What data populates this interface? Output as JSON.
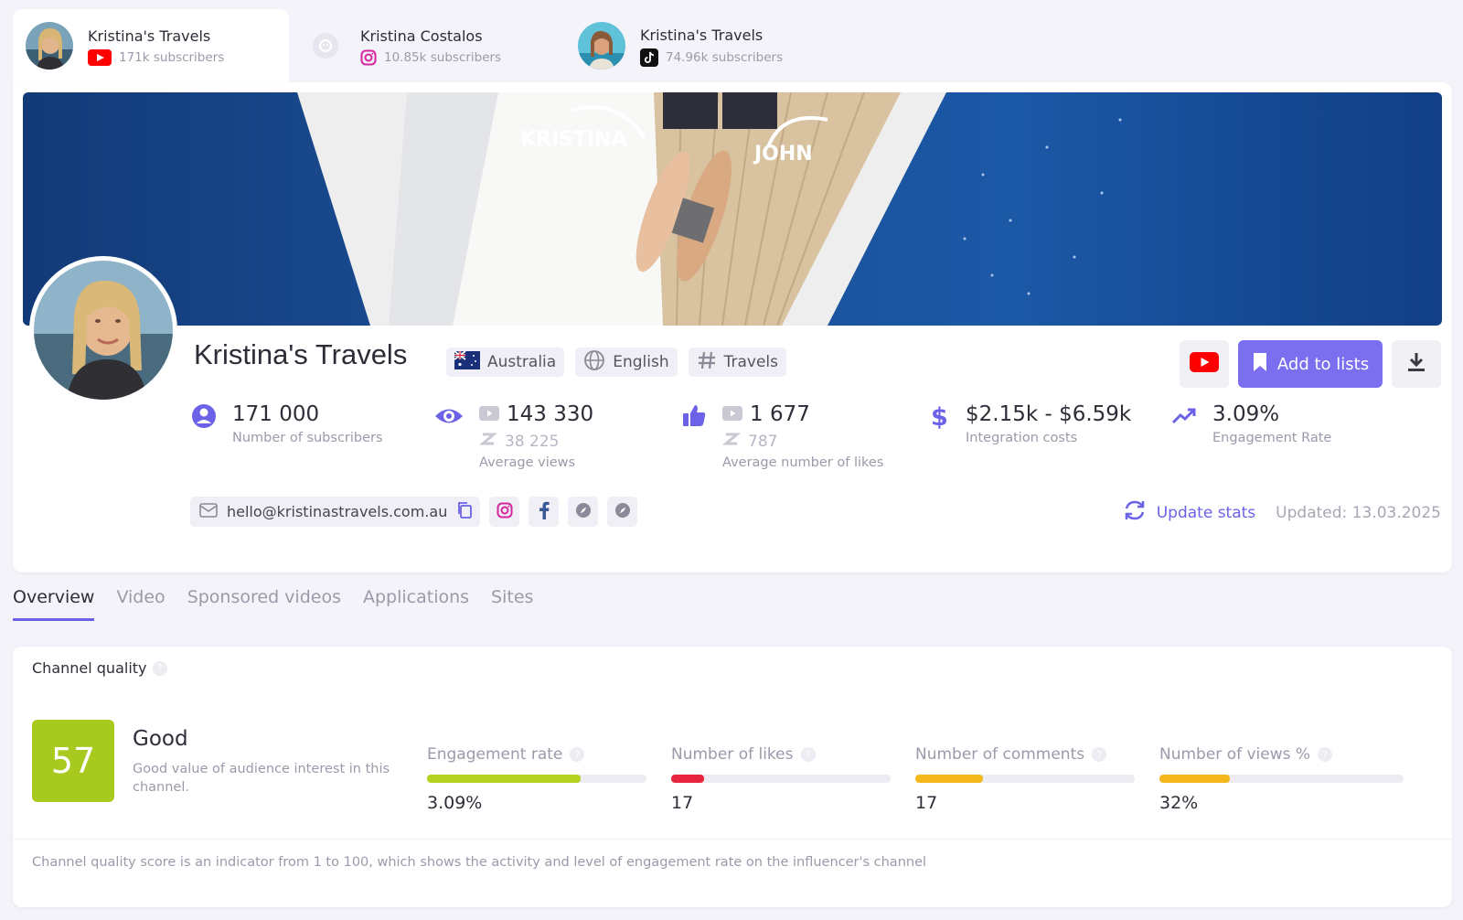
{
  "accounts": [
    {
      "name": "Kristina's Travels",
      "subscribers": "171k subscribers",
      "platform_icon": "youtube-icon",
      "active": true
    },
    {
      "name": "Kristina Costalos",
      "subscribers": "10.85k subscribers",
      "platform_icon": "instagram-icon",
      "active": false
    },
    {
      "name": "Kristina's Travels",
      "subscribers": "74.96k subscribers",
      "platform_icon": "tiktok-icon",
      "active": false
    }
  ],
  "banner": {
    "label_left": "KRISTINA",
    "label_right": "JOHN"
  },
  "channel": {
    "title": "Kristina's Travels",
    "country": "Australia",
    "language": "English",
    "category": "Travels"
  },
  "actions": {
    "add_to_lists": "Add to lists"
  },
  "stats": {
    "subscribers": {
      "value": "171 000",
      "label": "Number of subscribers"
    },
    "views": {
      "value": "143 330",
      "sub_value": "38 225",
      "label": "Average views"
    },
    "likes": {
      "value": "1 677",
      "sub_value": "787",
      "label": "Average number of likes"
    },
    "cost": {
      "value": "$2.15k - $6.59k",
      "label": "Integration costs"
    },
    "engagement": {
      "value": "3.09%",
      "label": "Engagement Rate"
    }
  },
  "contact": {
    "email": "hello@kristinastravels.com.au"
  },
  "update": {
    "link": "Update stats",
    "updated": "Updated: 13.03.2025"
  },
  "tabs": [
    "Overview",
    "Video",
    "Sponsored videos",
    "Applications",
    "Sites"
  ],
  "quality": {
    "title": "Channel quality",
    "score": "57",
    "score_label": "Good",
    "score_desc": "Good value of audience interest in this channel.",
    "metrics": [
      {
        "name": "Engagement rate",
        "value": "3.09%",
        "fill": 0.7,
        "color": "#b5d11f"
      },
      {
        "name": "Number of likes",
        "value": "17",
        "fill": 0.15,
        "color": "#e8253f"
      },
      {
        "name": "Number of comments",
        "value": "17",
        "fill": 0.31,
        "color": "#f5b81c"
      },
      {
        "name": "Number of views %",
        "value": "32%",
        "fill": 0.29,
        "color": "#f5b81c"
      }
    ],
    "footnote": "Channel quality score is an indicator from 1 to 100, which shows the activity and level of engagement rate on the influencer's channel"
  },
  "colors": {
    "accent": "#6b62e8",
    "button": "#7b6ff0",
    "score_bg": "#a8c91e",
    "youtube": "#ff0000"
  }
}
